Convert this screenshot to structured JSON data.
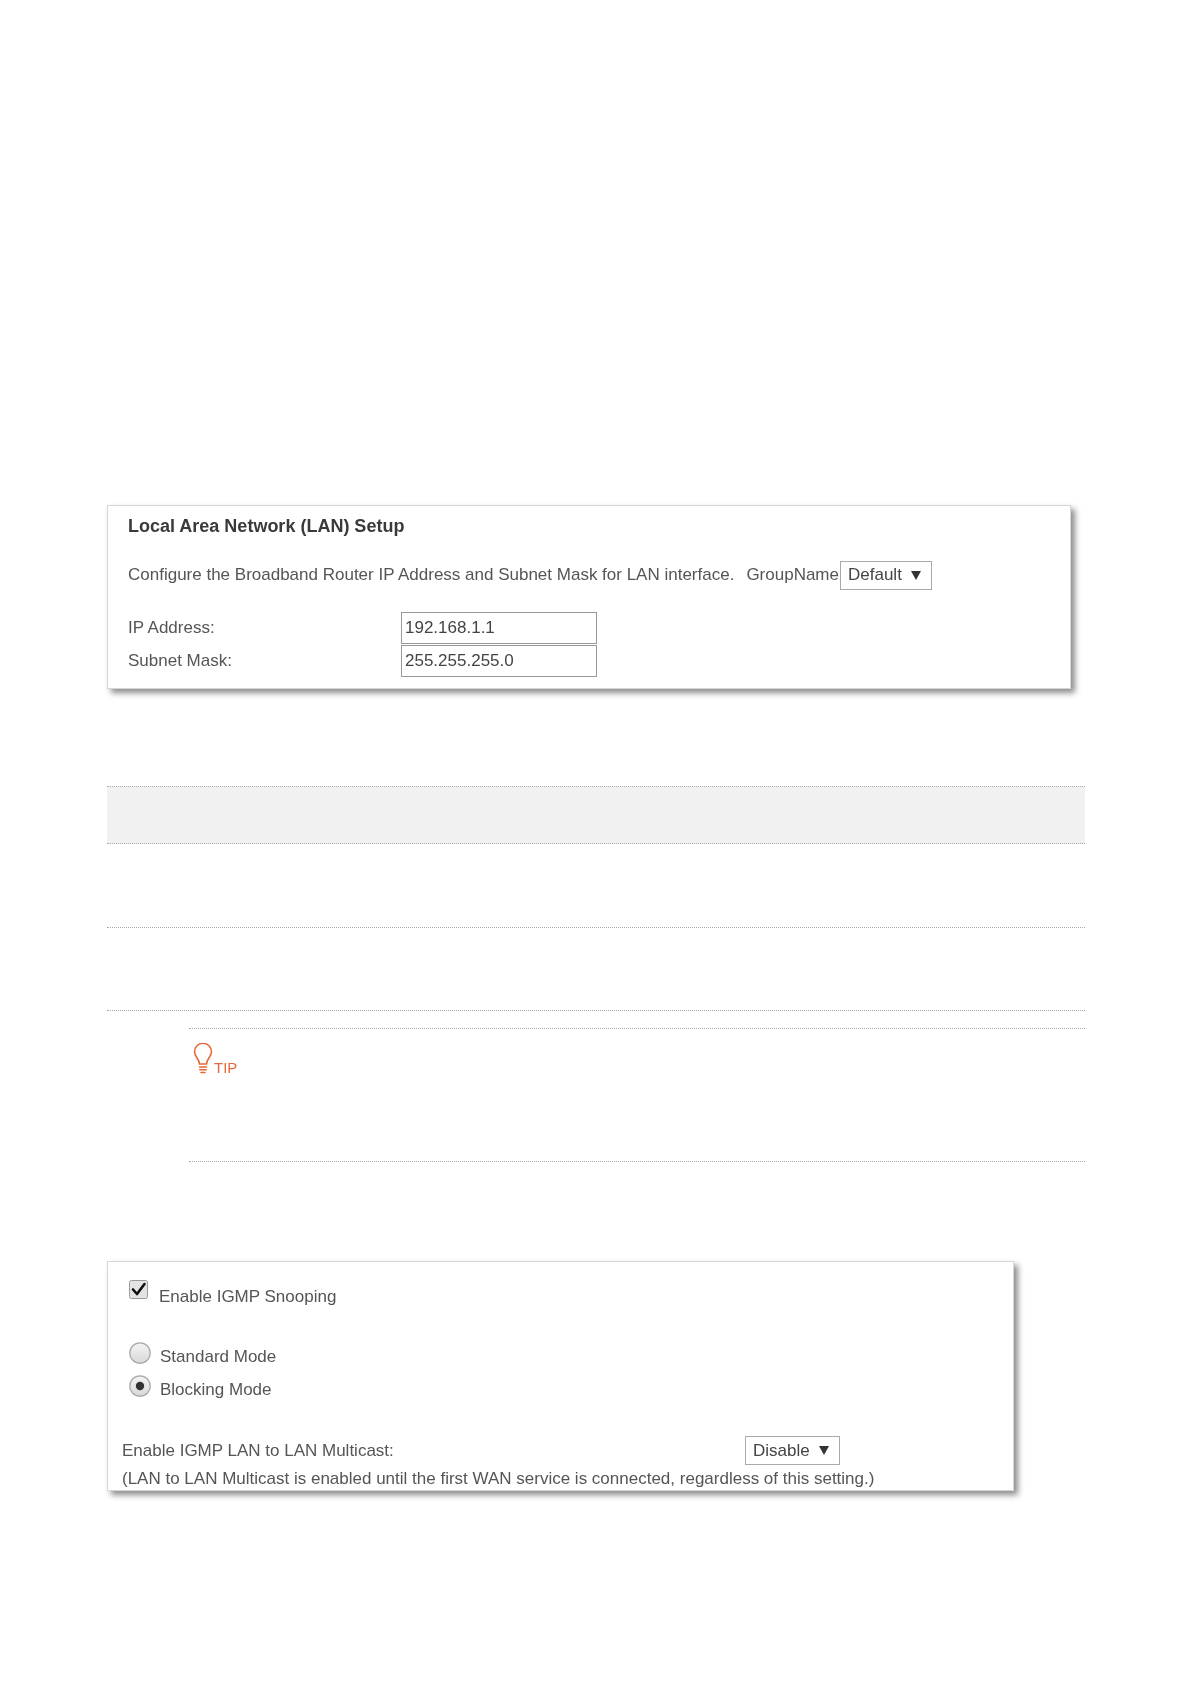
{
  "lan_setup": {
    "title": "Local Area Network (LAN) Setup",
    "description": "Configure the Broadband Router IP Address and Subnet Mask for LAN interface.",
    "group_name": {
      "label": "GroupName",
      "value": "Default"
    },
    "fields": [
      {
        "label": "IP Address:",
        "value": "192.168.1.1"
      },
      {
        "label": "Subnet Mask:",
        "value": "255.255.255.0"
      }
    ]
  },
  "tip": {
    "label": "TIP"
  },
  "igmp": {
    "snooping": {
      "label": "Enable IGMP Snooping",
      "checked": true
    },
    "modes": [
      {
        "label": "Standard Mode",
        "selected": false
      },
      {
        "label": "Blocking Mode",
        "selected": true
      }
    ],
    "lan_to_lan": {
      "label": "Enable IGMP LAN to LAN Multicast:",
      "value": "Disable"
    },
    "note": "(LAN to LAN Multicast is enabled until the first WAN service is connected, regardless of this setting.)"
  }
}
